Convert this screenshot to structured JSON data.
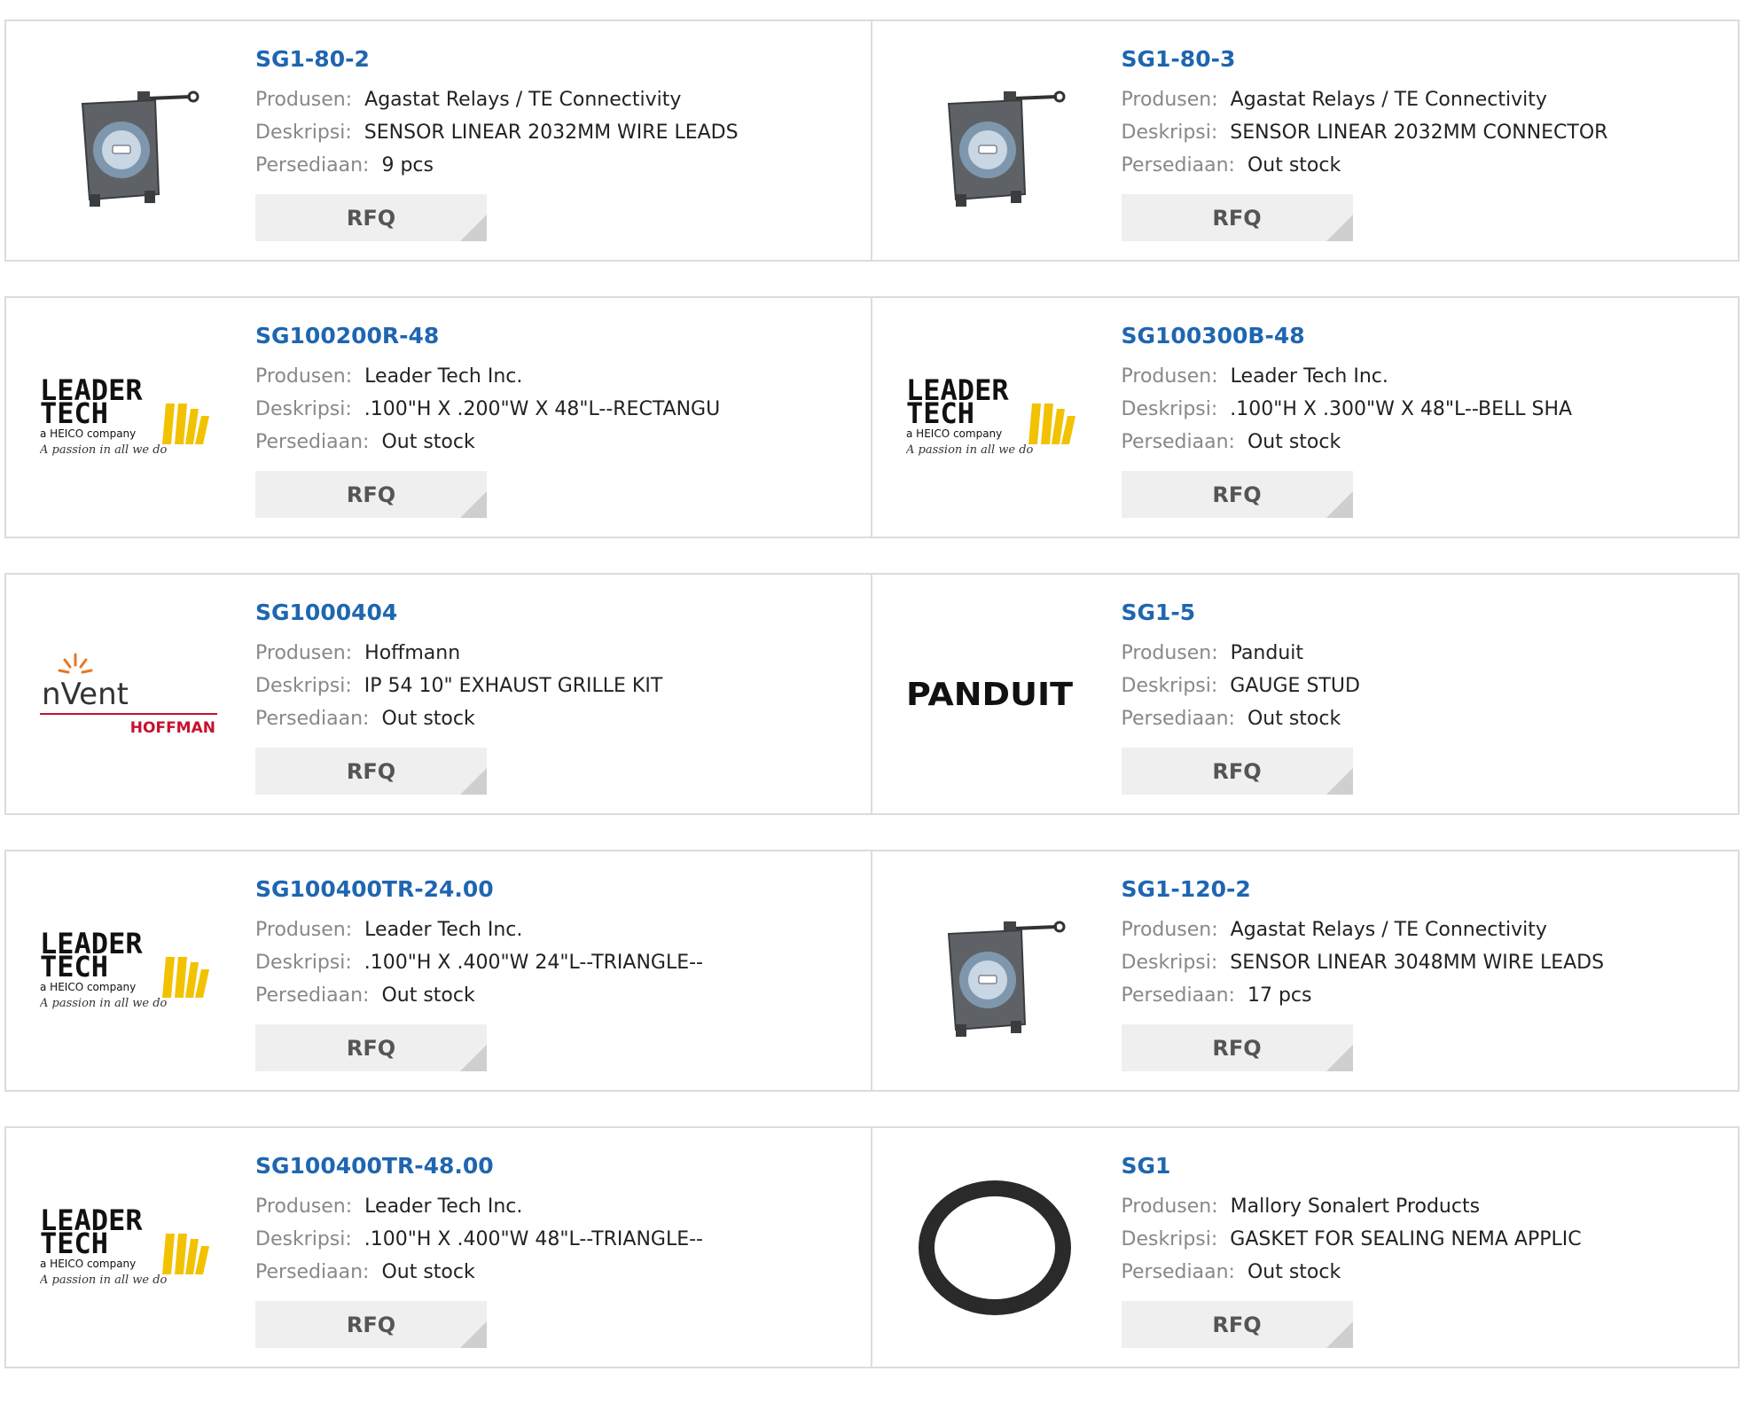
{
  "labels": {
    "manufacturer": "Produsen:",
    "description": "Deskripsi:",
    "stock": "Persediaan:",
    "rfq": "RFQ"
  },
  "products": [
    {
      "name": "SG1-80-2",
      "manufacturer": "Agastat Relays / TE Connectivity",
      "description": "SENSOR LINEAR 2032MM WIRE LEADS",
      "stock": "9 pcs",
      "image": "linear-sensor"
    },
    {
      "name": "SG1-80-3",
      "manufacturer": "Agastat Relays / TE Connectivity",
      "description": "SENSOR LINEAR 2032MM CONNECTOR",
      "stock": "Out stock",
      "image": "linear-sensor"
    },
    {
      "name": "SG100200R-48",
      "manufacturer": "Leader Tech Inc.",
      "description": ".100\"H X .200\"W X 48\"L--RECTANGU",
      "stock": "Out stock",
      "image": "leadertech-logo"
    },
    {
      "name": "SG100300B-48",
      "manufacturer": "Leader Tech Inc.",
      "description": ".100\"H X .300\"W X 48\"L--BELL SHA",
      "stock": "Out stock",
      "image": "leadertech-logo"
    },
    {
      "name": "SG1000404",
      "manufacturer": "Hoffmann",
      "description": "IP 54 10\" EXHAUST GRILLE KIT",
      "stock": "Out stock",
      "image": "nvent-hoffman-logo"
    },
    {
      "name": "SG1-5",
      "manufacturer": "Panduit",
      "description": "GAUGE STUD",
      "stock": "Out stock",
      "image": "panduit-logo"
    },
    {
      "name": "SG100400TR-24.00",
      "manufacturer": "Leader Tech Inc.",
      "description": ".100\"H X .400\"W 24\"L--TRIANGLE--",
      "stock": "Out stock",
      "image": "leadertech-logo"
    },
    {
      "name": "SG1-120-2",
      "manufacturer": "Agastat Relays / TE Connectivity",
      "description": "SENSOR LINEAR 3048MM WIRE LEADS",
      "stock": "17 pcs",
      "image": "linear-sensor"
    },
    {
      "name": "SG100400TR-48.00",
      "manufacturer": "Leader Tech Inc.",
      "description": ".100\"H X .400\"W 48\"L--TRIANGLE--",
      "stock": "Out stock",
      "image": "leadertech-logo"
    },
    {
      "name": "SG1",
      "manufacturer": "Mallory Sonalert Products",
      "description": "GASKET FOR SEALING NEMA APPLIC",
      "stock": "Out stock",
      "image": "gasket-ring"
    }
  ],
  "logo_text": {
    "leadertech_line1": "LEADER",
    "leadertech_line2": "TECH",
    "leadertech_sub": "a HEICO company",
    "leadertech_tagline": "A passion in all we do",
    "nvent": "nVent",
    "hoffman": "HOFFMAN",
    "panduit": "PANDUIT"
  },
  "colors": {
    "link": "#1f66b0",
    "label": "#888888",
    "border": "#dcdcdc",
    "rfq_bg": "#efefef"
  }
}
